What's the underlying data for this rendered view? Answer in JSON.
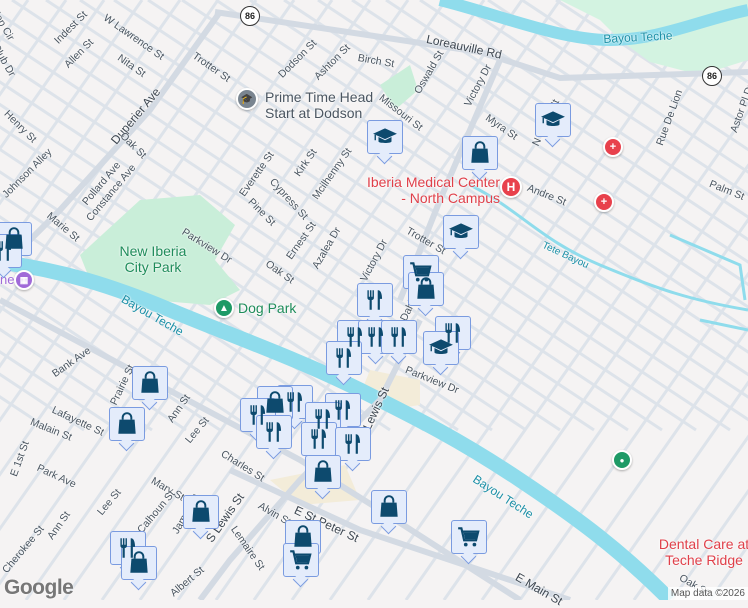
{
  "map": {
    "colors": {
      "water": "#8fdcec",
      "park": "#c9eed9",
      "major_road": "#d3dae3",
      "minor_road": "#dde3ea",
      "commercial": "#f3ecd9",
      "pin_icon": "#0d4a6e",
      "medical": "#e8414c",
      "green_poi": "#1e9a66",
      "museum": "#a06ad8"
    },
    "icons": {
      "school": "graduation-cap-icon",
      "shop": "shopping-bag-icon",
      "grocery": "shopping-cart-icon",
      "restaurant": "fork-knife-icon",
      "hospital": "hospital-icon",
      "medical": "medical-cross-icon",
      "park": "tree-icon",
      "museum": "museum-icon",
      "place": "place-pin-icon"
    },
    "highway_shield": "86",
    "streets": [
      "Indest St",
      "W Lawrence St",
      "Allen St",
      "Nita St",
      "Trotter St",
      "Dodson St",
      "Ashton St",
      "Birch St",
      "Oswald St",
      "Loreauville Rd",
      "Victory Dr",
      "Missouri St",
      "Myra St",
      "N Lewis St",
      "Duperier Ave",
      "Henry St",
      "Johnson Alley",
      "Oak St",
      "Pollard Ave",
      "Constance Ave",
      "Marie St",
      "Everette St",
      "Kirk St",
      "Cypress St",
      "Mcilhenny St",
      "Pine St",
      "Ernest St",
      "Azalea Dr",
      "Parkview Dr",
      "Oak St",
      "Victory Dr",
      "Trotter St",
      "Andre St",
      "Rue De Lion",
      "Astor Pl Dr",
      "Palm St",
      "Parkview Dr",
      "Bank Ave",
      "Prairie St",
      "Ann St",
      "Lafayette St",
      "Malain St",
      "Lee St",
      "Charles St",
      "E 1st St",
      "Park Ave",
      "Mary St",
      "Lee St",
      "Ann St",
      "Cherokee St",
      "Calhoun St",
      "James St",
      "S Lewis St",
      "Alvin St",
      "Lemaire St",
      "E St Peter St",
      "Albert St",
      "E Main St",
      "Lewis St",
      "Dahlia St",
      "Jop Cir",
      "Club Dr",
      "Oak St"
    ],
    "water_labels": [
      "Bayou Teche",
      "Bayou Teche",
      "Bayou Teche",
      "Tete Bayou"
    ],
    "places": {
      "head_start": "Prime Time Head Start at Dodson",
      "city_park": "New Iberia City Park",
      "dog_park": "Dog Park",
      "medical_center": "Iberia Medical Center - North Campus",
      "dental": "Dental Care at Teche Ridge",
      "museum_partial": "ne"
    },
    "hospital_letter": "H",
    "google_logo": "Google",
    "attribution": "Map data ©2026"
  }
}
